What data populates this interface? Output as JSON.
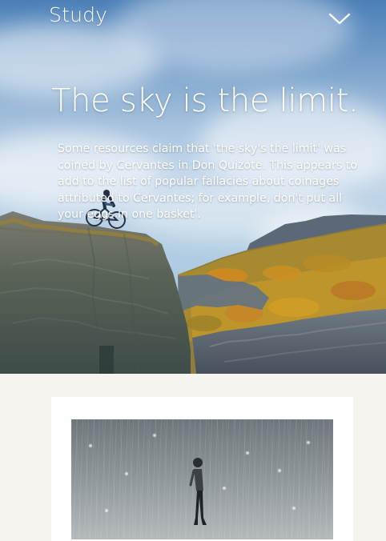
{
  "header": {
    "brand": "Study",
    "menu_icon": "chevron-down-icon"
  },
  "hero": {
    "title": "The sky is the limit.",
    "text": "Some resources claim that 'the sky's the limit' was coined by Cervantes in Don Quizote. This appears to add to the list of popular fallacies about coinages attributed to Cervantes; for example, don't put all your eggs in one basket'."
  },
  "card": {
    "image_label": "person-in-rain-photo"
  },
  "colors": {
    "background": "#f5f4ef",
    "card": "#ffffff",
    "text_on_hero": "#ffffff"
  }
}
